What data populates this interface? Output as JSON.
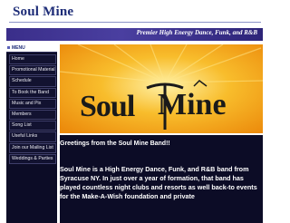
{
  "site": {
    "title": "Soul Mine",
    "tagline": "Premier High Energy Dance, Funk, and R&B"
  },
  "sidebar": {
    "header": "MENU",
    "items": [
      {
        "label": "Home"
      },
      {
        "label": "Promotional Material"
      },
      {
        "label": "Schedule"
      },
      {
        "label": "To Book the Band"
      },
      {
        "label": "Music and Pix"
      },
      {
        "label": "Members"
      },
      {
        "label": "Song List"
      },
      {
        "label": "Useful Links"
      },
      {
        "label": "Join our Mailing List"
      },
      {
        "label": "Weddings & Parties"
      }
    ]
  },
  "banner": {
    "logo_left": "Soul",
    "logo_right": "Mine"
  },
  "main": {
    "greeting": "Greetings from the Soul Mine Band!!",
    "intro": "Soul Mine is a High Energy Dance, Funk, and R&B band from Syracuse NY.  In just over a year of formation, that band has played countless night clubs and resorts as well back-to events for the Make-A-Wish foundation and private"
  },
  "colors": {
    "title": "#1d2c77",
    "tagline_bar": "#3a2e8a",
    "sidebar_bg": "#0c0c26",
    "banner_bg": "#f5a415"
  }
}
